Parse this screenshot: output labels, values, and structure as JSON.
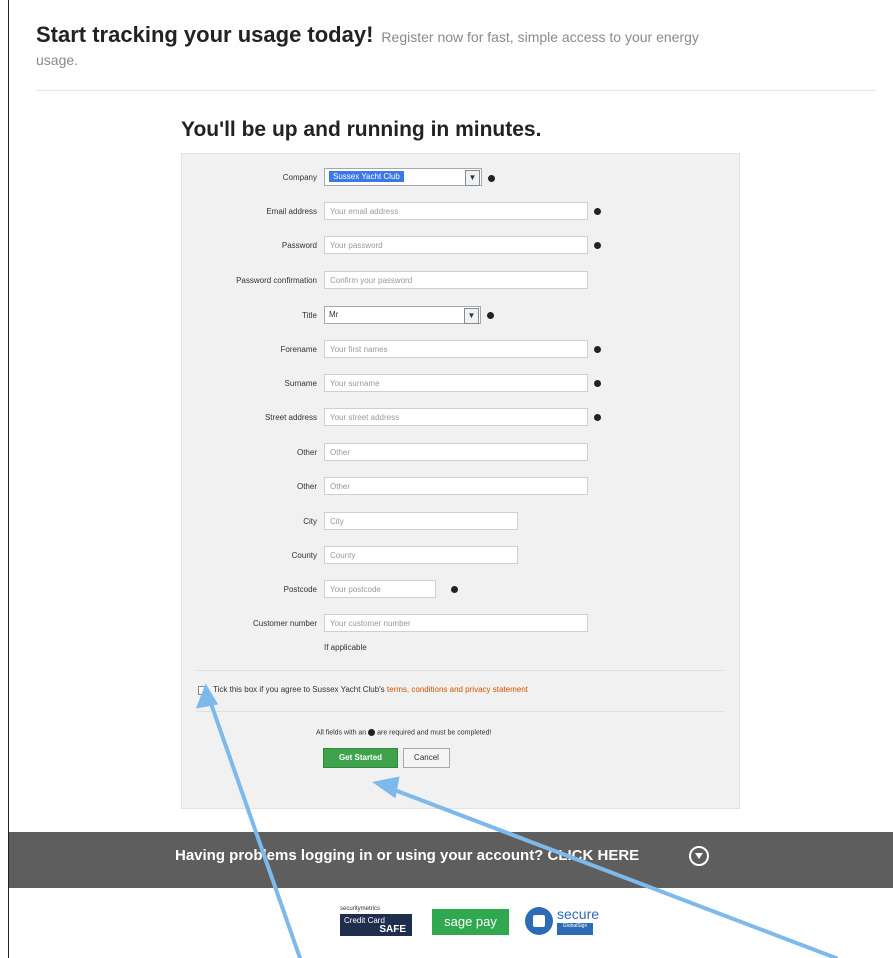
{
  "header": {
    "title": "Start tracking your usage today!",
    "subtitle_part1": "Register now for fast, simple access to your energy",
    "subtitle_part2": "usage."
  },
  "form": {
    "heading": "You'll be up and running in minutes.",
    "company": {
      "label": "Company",
      "value": "Sussex Yacht Club"
    },
    "email": {
      "label": "Email address",
      "placeholder": "Your email address"
    },
    "password": {
      "label": "Password",
      "placeholder": "Your password"
    },
    "password_confirm": {
      "label": "Password confirmation",
      "placeholder": "Confirm your password"
    },
    "title": {
      "label": "Title",
      "value": "Mr"
    },
    "forename": {
      "label": "Forename",
      "placeholder": "Your first names"
    },
    "surname": {
      "label": "Surname",
      "placeholder": "Your surname"
    },
    "street": {
      "label": "Street address",
      "placeholder": "Your street address"
    },
    "other1": {
      "label": "Other",
      "placeholder": "Other"
    },
    "other2": {
      "label": "Other",
      "placeholder": "Other"
    },
    "city": {
      "label": "City",
      "placeholder": "City"
    },
    "county": {
      "label": "County",
      "placeholder": "County"
    },
    "postcode": {
      "label": "Postcode",
      "placeholder": "Your postcode"
    },
    "customer_number": {
      "label": "Customer number",
      "placeholder": "Your customer number",
      "note": "If applicable"
    },
    "agree_text": "Tick this box if you agree to Sussex Yacht Club's",
    "agree_link": "terms, conditions and privacy statement",
    "required_note_part1": "All fields with an",
    "required_note_part2": "are required and must be completed!",
    "submit_label": "Get Started",
    "cancel_label": "Cancel"
  },
  "footer": {
    "help_text": "Having problems logging in or using your account? CLICK HERE"
  },
  "badges": {
    "cc_top": "securitymetrics",
    "cc_line1": "Credit Card",
    "cc_line2": "SAFE",
    "sagepay": "sage pay",
    "secure": "secure",
    "secure_sub": "GlobalSign"
  },
  "annotation_color": "#7db9ea"
}
